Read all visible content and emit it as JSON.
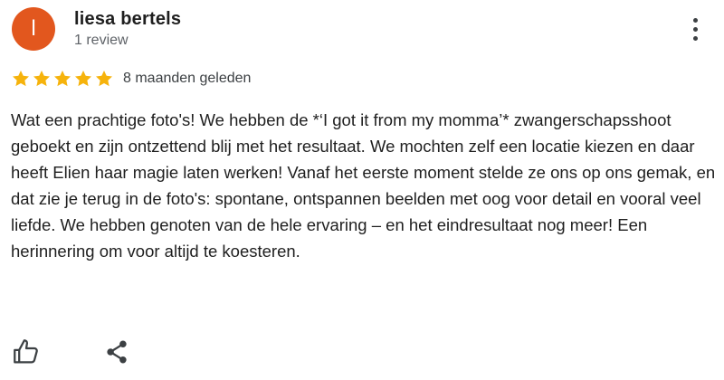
{
  "review": {
    "author": {
      "initial": "l",
      "name": "liesa bertels",
      "review_count": "1 review",
      "avatar_color": "#e2571e"
    },
    "menu_icon": "more-vert-icon",
    "rating": 5,
    "rating_max": 5,
    "star_color": "#f6b30c",
    "date": "8 maanden geleden",
    "text": "Wat een prachtige foto's! We hebben de *‘I got it from my momma’* zwangerschapsshoot geboekt en zijn ontzettend blij met het resultaat. We mochten zelf een locatie kiezen en daar heeft Elien haar magie laten werken! Vanaf het eerste moment stelde ze ons op ons gemak, en dat zie je terug in de foto's: spontane, ontspannen beelden met oog voor detail en vooral veel liefde. We hebben genoten van de hele ervaring – en het eindresultaat nog meer! Een herinnering om voor altijd te koesteren."
  },
  "actions": {
    "like_icon": "thumbs-up-icon",
    "share_icon": "share-icon"
  }
}
